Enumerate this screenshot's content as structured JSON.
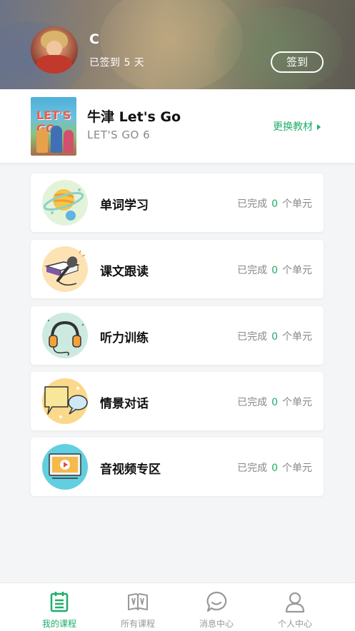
{
  "header": {
    "username": "C",
    "signed_text": "已签到 5 天",
    "signin_button": "签到"
  },
  "textbook": {
    "title": "牛津 Let's Go",
    "subtitle": "LET'S GO 6",
    "change_label": "更换教材",
    "cover_text": "LET'S GO"
  },
  "modules": [
    {
      "title": "单词学习",
      "prefix": "已完成",
      "count": "0",
      "suffix": "个单元",
      "icon": "planet-icon"
    },
    {
      "title": "课文跟读",
      "prefix": "已完成",
      "count": "0",
      "suffix": "个单元",
      "icon": "book-microphone-icon"
    },
    {
      "title": "听力训练",
      "prefix": "已完成",
      "count": "0",
      "suffix": "个单元",
      "icon": "headphones-icon"
    },
    {
      "title": "情景对话",
      "prefix": "已完成",
      "count": "0",
      "suffix": "个单元",
      "icon": "speech-bubbles-icon"
    },
    {
      "title": "音视频专区",
      "prefix": "已完成",
      "count": "0",
      "suffix": "个单元",
      "icon": "video-player-icon"
    }
  ],
  "tabs": [
    {
      "label": "我的课程",
      "icon": "clipboard-list-icon",
      "active": true
    },
    {
      "label": "所有课程",
      "icon": "open-book-icon",
      "active": false
    },
    {
      "label": "消息中心",
      "icon": "chat-bubble-icon",
      "active": false
    },
    {
      "label": "个人中心",
      "icon": "person-icon",
      "active": false
    }
  ],
  "colors": {
    "accent": "#1fae6a",
    "background": "#f4f5f7"
  }
}
